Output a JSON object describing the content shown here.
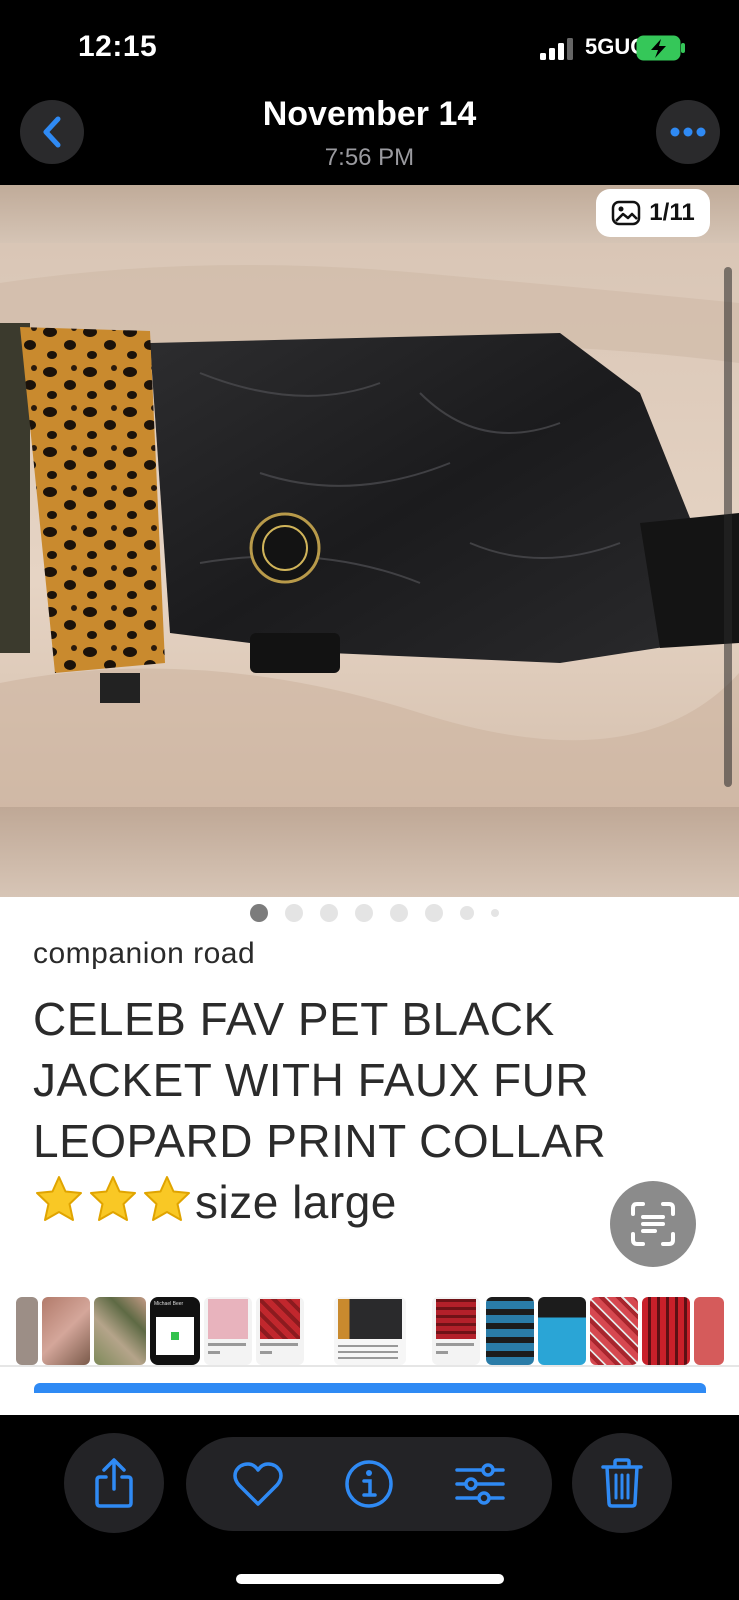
{
  "status_bar": {
    "time": "12:15",
    "network": "5GUC"
  },
  "header": {
    "title": "November 14",
    "subtitle": "7:56 PM"
  },
  "photo": {
    "counter": "1/11",
    "total_dots": 8,
    "active_dot": 1
  },
  "listing": {
    "brand": "companion road",
    "title": "CELEB FAV PET  BLACK JACKET WITH FAUX FUR LEOPARD PRINT COLLAR",
    "size_text": "size large",
    "star_count": 3
  },
  "thumbnails": {
    "user_card_name": "Michael Beer"
  },
  "colors": {
    "accent_blue": "#2f8af4",
    "star_yellow": "#f9c825",
    "toolbar_button_bg": "#232326"
  }
}
